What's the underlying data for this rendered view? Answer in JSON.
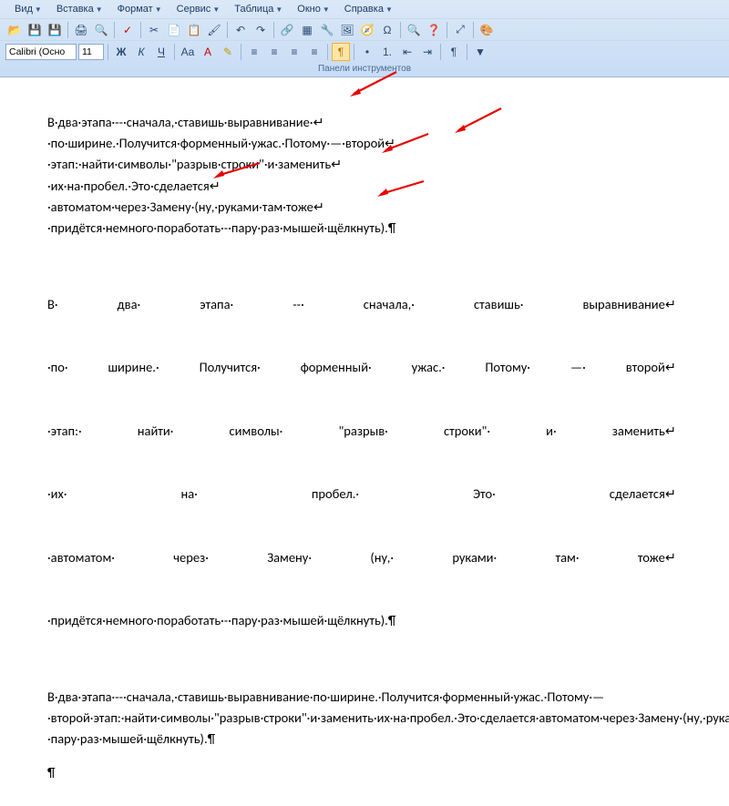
{
  "menu": {
    "items": [
      "Вид",
      "Вставка",
      "Формат",
      "Сервис",
      "Таблица",
      "Окно",
      "Справка"
    ]
  },
  "font": {
    "name": "Calibri (Осно",
    "size": "11"
  },
  "toolbars_caption": "Панели инструментов",
  "paragraphs": {
    "p1": "В·два·этапа·--·сначала,·ставишь·выравнивание·↵\n·по·ширине.·Получится·форменный·ужас.·Потому·—·второй↵\n·этап:·найти·символы·\"разрыв·строки\"·и·заменить↵\n·их·на·пробел.·Это·сделается↵\n·автоматом·через·Замену·(ну,·руками·там·тоже↵\n·придётся·немного·поработать·-·пару·раз·мышей·щёлкнуть).¶",
    "p2_lines": [
      "В· два· этапа· --· сначала,· ставишь· выравнивание↵",
      "·по· ширине.· Получится· форменный· ужас.· Потому· —· второй↵",
      "·этап:· найти· символы· \"разрыв· строки\"· и· заменить↵",
      "·их· на· пробел.· Это· сделается↵",
      "·автоматом· через· Замену· (ну,· руками· там· тоже↵",
      "·придётся·немного·поработать·-·пару·раз·мышей·щёлкнуть).¶"
    ],
    "p3": "В·два·этапа·--·сначала,·ставишь·выравнивание·по·ширине.·Получится·форменный·ужас.·Потому·—·второй·этап:·найти·символы·\"разрыв·строки\"·и·заменить·их·на·пробел.·Это·сделается·автоматом·через·Замену·(ну,·руками·там·тоже·придётся·немного·поработать·-·пару·раз·мышей·щёлкнуть).¶",
    "p4": "¶"
  },
  "icons": {
    "open": "📂",
    "save": "💾",
    "export": "💾",
    "print": "🖨",
    "preview": "🔍",
    "spell": "✓",
    "cut": "✂",
    "copy": "📄",
    "paste": "📋",
    "brush": "🖌",
    "undo": "↶",
    "redo": "↷",
    "link": "🔗",
    "table": "▦",
    "toolbox": "🔧",
    "gallery": "🖼",
    "navigator": "🧭",
    "chars": "Ω",
    "find": "🔍",
    "help": "❓",
    "zoom": "⤢",
    "color": "🎨",
    "bold": "Ж",
    "italic": "К",
    "underline": "Ч",
    "left": "≡",
    "center": "≡",
    "right": "≡",
    "justify": "≡",
    "bullets": "•",
    "numbers": "1.",
    "outdent": "⇤",
    "indent": "⇥",
    "highlight": "✎",
    "fontcolor": "A",
    "indent2": "¶",
    "pilcrow": "¶",
    "case": "Aa"
  }
}
